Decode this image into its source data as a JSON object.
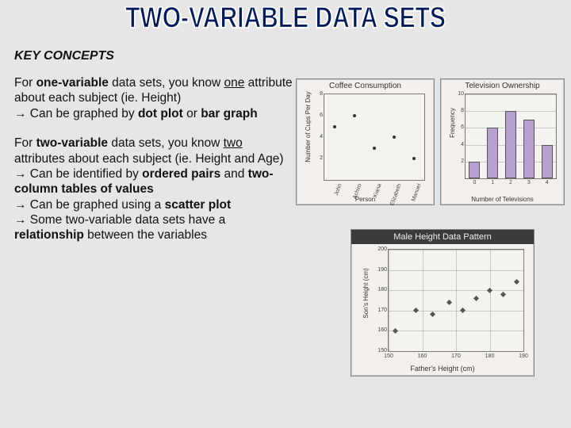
{
  "title": "TWO-VARIABLE DATA SETS",
  "kc": "KEY CONCEPTS",
  "p1a": "For ",
  "p1b": "one-variable",
  "p1c": " data sets, you know ",
  "p1d": "one",
  "p1e": " attribute about each subject (ie. Height)",
  "p1arrow": "→ Can be graphed by ",
  "p1f": "dot plot",
  "p1g": " or ",
  "p1h": "bar graph",
  "p2a": "For ",
  "p2b": "two-variable",
  "p2c": " data sets, you know ",
  "p2d": "two",
  "p2e": " attributes about each subject (ie. Height and Age)",
  "p2arrow1": "→ Can be identified by ",
  "p2f": "ordered pairs",
  "p2g": " and ",
  "p2h": "two-column tables of values",
  "p2arrow2": "→ Can be graphed using a ",
  "p2i": "scatter plot",
  "p2arrow3": "→ Some two-variable data sets have a ",
  "p2j": "relationship",
  "p2k": " between the variables",
  "coffee": {
    "title": "Coffee Consumption",
    "ylabel": "Number of Cups Per Day",
    "xlabel": "Person"
  },
  "tv": {
    "title": "Television Ownership",
    "ylabel": "Frequency",
    "xlabel": "Number of Televisions"
  },
  "height": {
    "title": "Male Height Data Pattern",
    "ylabel": "Son's Height (cm)",
    "xlabel": "Father's Height (cm)"
  },
  "chart_data": [
    {
      "type": "scatter",
      "title": "Coffee Consumption",
      "xlabel": "Person",
      "ylabel": "Number of Cups Per Day",
      "categories": [
        "John",
        "Achiro",
        "Kiana",
        "Elizabeth",
        "Manuel"
      ],
      "values": [
        5,
        6,
        3,
        4,
        2
      ],
      "ylim": [
        0,
        8
      ]
    },
    {
      "type": "bar",
      "title": "Television Ownership",
      "xlabel": "Number of Televisions",
      "ylabel": "Frequency",
      "categories": [
        "0",
        "1",
        "2",
        "3",
        "4"
      ],
      "values": [
        2,
        6,
        8,
        7,
        4
      ],
      "ylim": [
        0,
        10
      ]
    },
    {
      "type": "scatter",
      "title": "Male Height Data Pattern",
      "xlabel": "Father's Height (cm)",
      "ylabel": "Son's Height (cm)",
      "x": [
        152,
        158,
        163,
        168,
        172,
        176,
        180,
        184,
        188
      ],
      "y": [
        160,
        170,
        168,
        174,
        170,
        176,
        180,
        178,
        184
      ],
      "xlim": [
        150,
        190
      ],
      "ylim": [
        150,
        200
      ],
      "xticks": [
        150,
        160,
        170,
        180,
        190
      ],
      "yticks": [
        150,
        160,
        170,
        180,
        190,
        200
      ]
    }
  ],
  "coffee_ticks": {
    "names": [
      "John",
      "Achiro",
      "Kiana",
      "Elizabeth",
      "Manuel"
    ],
    "yvals": [
      "2",
      "4",
      "6",
      "8"
    ]
  },
  "tv_ticks": {
    "x": [
      "0",
      "1",
      "2",
      "3",
      "4"
    ],
    "y": [
      "2",
      "4",
      "6",
      "8",
      "10"
    ]
  },
  "height_ticks": {
    "x": [
      "150",
      "160",
      "170",
      "180",
      "190"
    ],
    "y": [
      "150",
      "160",
      "170",
      "180",
      "190",
      "200"
    ]
  }
}
